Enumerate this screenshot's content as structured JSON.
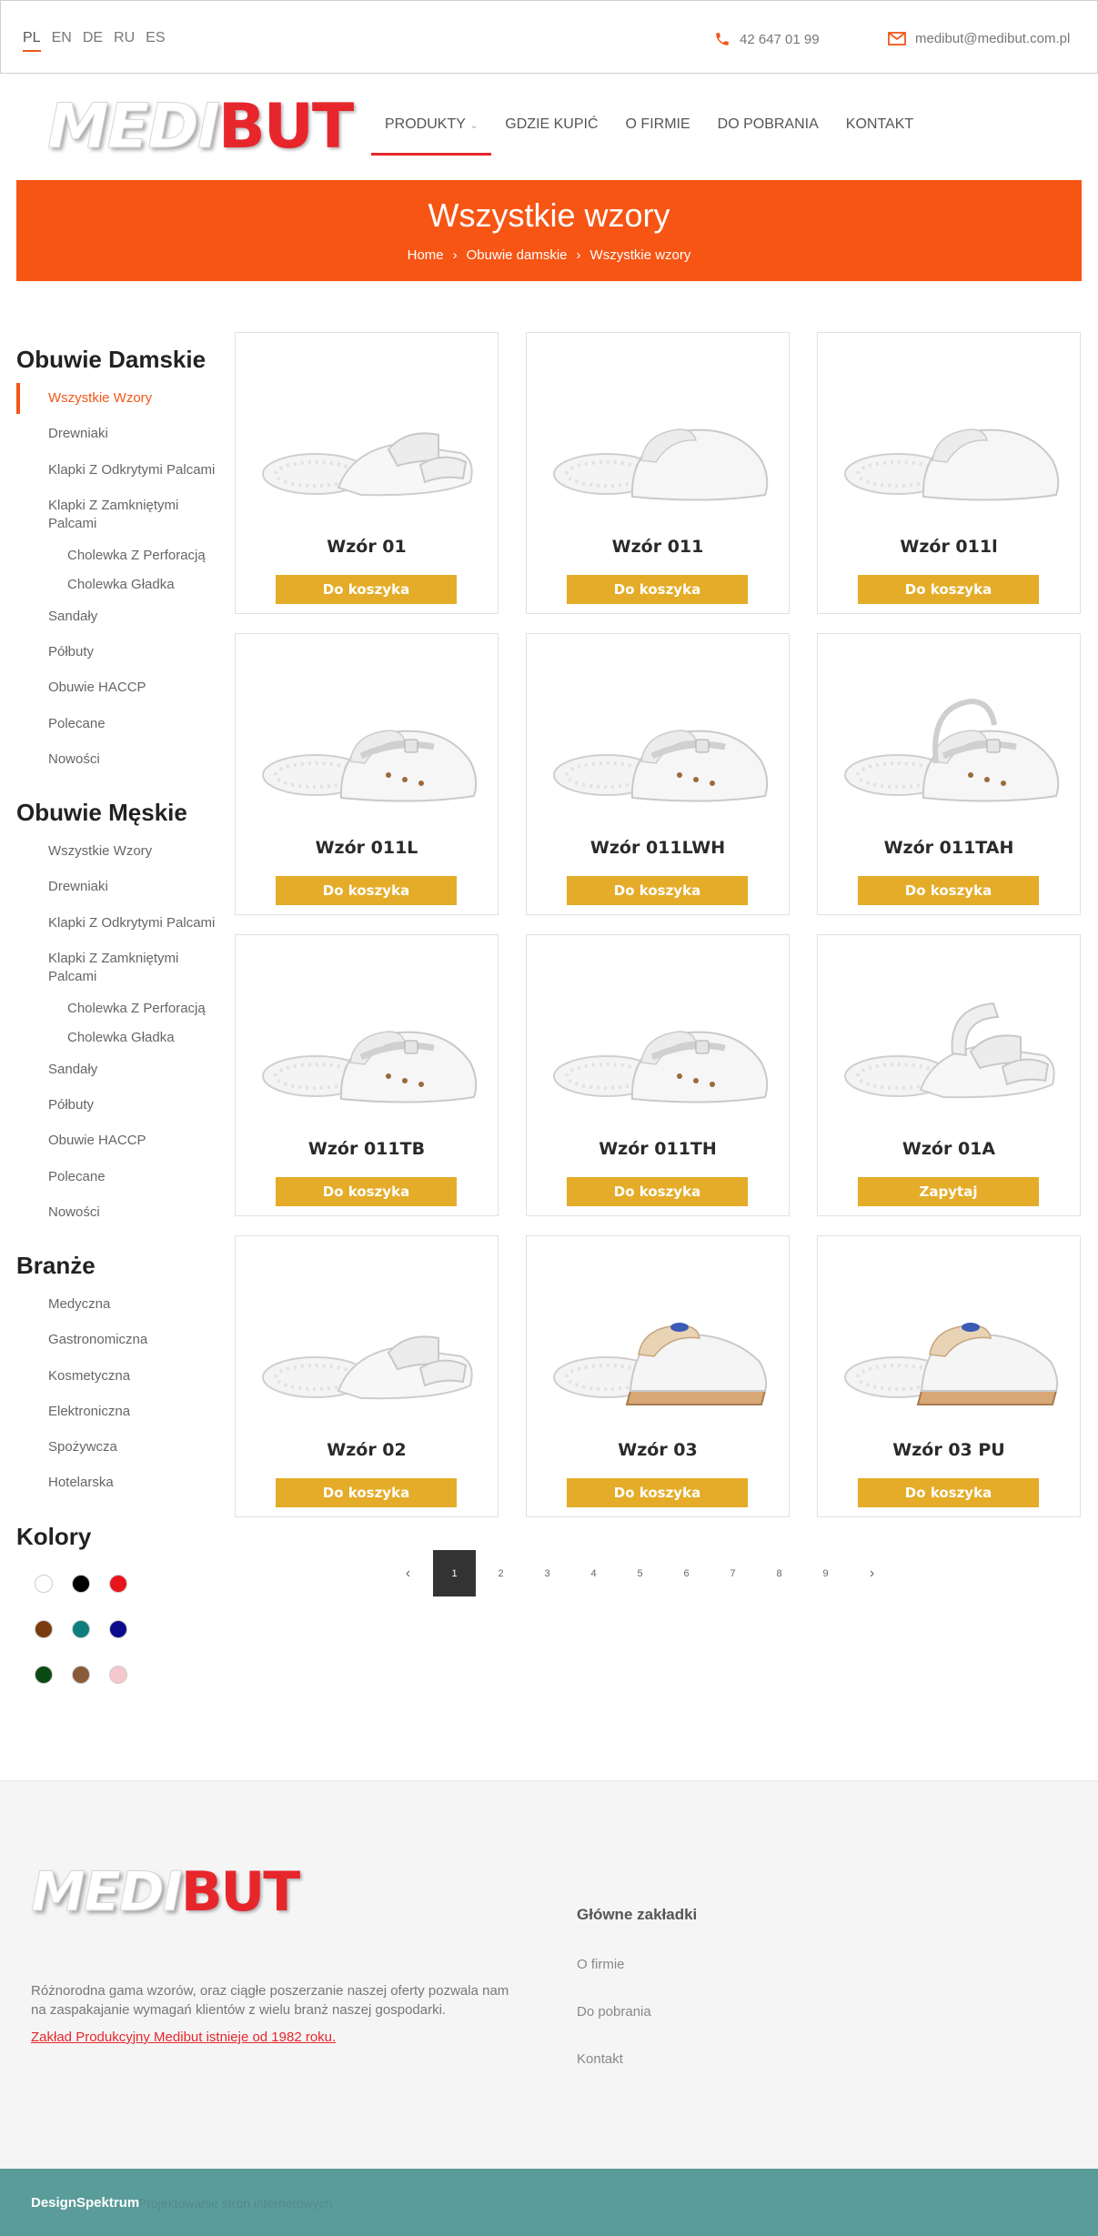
{
  "topbar": {
    "languages": [
      "PL",
      "EN",
      "DE",
      "RU",
      "ES"
    ],
    "active_language": "PL",
    "phone": "42 647 01 99",
    "email": "medibut@medibut.com.pl",
    "phone_icon": "phone-icon",
    "email_icon": "envelope-icon",
    "accent_color": "#f2561a"
  },
  "logo": {
    "part1": "MEDI",
    "part2": "BUT"
  },
  "nav": [
    "PRODUKTY",
    "GDZIE KUPIĆ",
    "O FIRMIE",
    "DO POBRANIA",
    "KONTAKT"
  ],
  "banner": {
    "title": "Wszystkie wzory",
    "breadcrumb": [
      "Home",
      "Obuwie damskie",
      "Wszystkie wzory"
    ],
    "color": "#f75514"
  },
  "sidebar": {
    "womens": {
      "heading": "Obuwie Damskie",
      "items": [
        "Wszystkie Wzory",
        "Drewniaki",
        "Klapki Z Odkrytymi Palcami",
        "Klapki Z Zamkniętymi Palcami",
        "Cholewka Z Perforacją",
        "Cholewka Gładka",
        "Sandały",
        "Półbuty",
        "Obuwie HACCP",
        "Polecane",
        "Nowości"
      ]
    },
    "mens": {
      "heading": "Obuwie Męskie",
      "items": [
        "Wszystkie Wzory",
        "Drewniaki",
        "Klapki Z Odkrytymi Palcami",
        "Klapki Z Zamkniętymi Palcami",
        "Cholewka Z Perforacją",
        "Cholewka Gładka",
        "Sandały",
        "Półbuty",
        "Obuwie HACCP",
        "Polecane",
        "Nowości"
      ]
    },
    "industries": {
      "heading": "Branże",
      "items": [
        "Medyczna",
        "Gastronomiczna",
        "Kosmetyczna",
        "Elektroniczna",
        "Spożywcza",
        "Hotelarska"
      ]
    },
    "colors": {
      "heading": "Kolory",
      "swatches": [
        "#ffffff",
        "#000000",
        "#e8141b",
        "#7a3b10",
        "#0d7d7d",
        "#0a0a8c",
        "#0c4a14",
        "#8b5a3a",
        "#f6c7cd"
      ]
    }
  },
  "products": [
    {
      "name": "Wzór 01",
      "button": "Do koszyka",
      "shape": "slide"
    },
    {
      "name": "Wzór 011",
      "button": "Do koszyka",
      "shape": "clog"
    },
    {
      "name": "Wzór 011l",
      "button": "Do koszyka",
      "shape": "clog"
    },
    {
      "name": "Wzór 011L",
      "button": "Do koszyka",
      "shape": "strap-clog"
    },
    {
      "name": "Wzór 011LWH",
      "button": "Do koszyka",
      "shape": "strap-clog"
    },
    {
      "name": "Wzór 011TAH",
      "button": "Do koszyka",
      "shape": "heel-strap-clog"
    },
    {
      "name": "Wzór 011TB",
      "button": "Do koszyka",
      "shape": "strap-clog"
    },
    {
      "name": "Wzór 011TH",
      "button": "Do koszyka",
      "shape": "strap-clog"
    },
    {
      "name": "Wzór 01A",
      "button": "Zapytaj",
      "shape": "sandal"
    },
    {
      "name": "Wzór 02",
      "button": "Do koszyka",
      "shape": "slide"
    },
    {
      "name": "Wzór 03",
      "button": "Do koszyka",
      "shape": "wooden-clog"
    },
    {
      "name": "Wzór 03 PU",
      "button": "Do koszyka",
      "shape": "wooden-clog"
    }
  ],
  "pagination": {
    "prev": "‹",
    "next": "›",
    "pages": [
      "1",
      "2",
      "3",
      "4",
      "5",
      "6",
      "7",
      "8",
      "9"
    ],
    "current": "1"
  },
  "footer": {
    "text": "Różnorodna gama wzorów, oraz ciągłe poszerzanie naszej oferty pozwala nam na zaspakajanie wymagań klientów z wielu branż naszej gospodarki.",
    "link": "Zakład Produkcyjny Medibut istnieje od 1982 roku.",
    "col_heading": "Główne zakładki",
    "col_links": [
      "O firmie",
      "Do pobrania",
      "Kontakt"
    ]
  },
  "bottombar": {
    "brand": "DesignSpektrum",
    "tag": "Projektowanie stron internetowych",
    "color": "#5a9c9a"
  }
}
